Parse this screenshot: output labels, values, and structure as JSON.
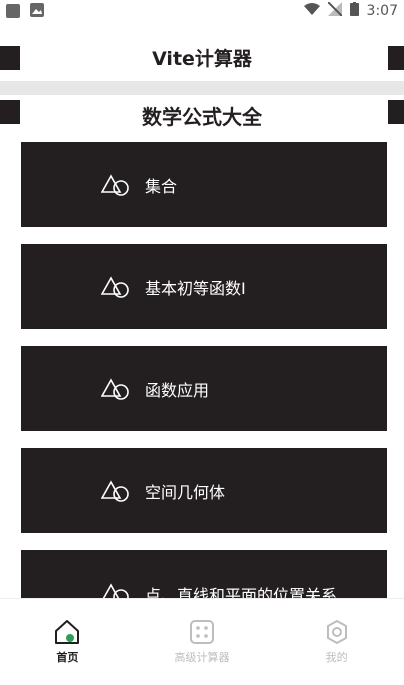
{
  "status_bar": {
    "time": "3:07"
  },
  "header": {
    "title": "Vite计算器"
  },
  "section": {
    "title": "数学公式大全"
  },
  "cards": [
    {
      "label": "集合"
    },
    {
      "label": "基本初等函数I"
    },
    {
      "label": "函数应用"
    },
    {
      "label": "空间几何体"
    },
    {
      "label": "点、直线和平面的位置关系"
    }
  ],
  "bottom_nav": {
    "items": [
      {
        "label": "首页",
        "icon": "home-icon",
        "active": true
      },
      {
        "label": "高级计算器",
        "icon": "calculator-icon",
        "active": false
      },
      {
        "label": "我的",
        "icon": "gear-icon",
        "active": false
      }
    ]
  },
  "colors": {
    "dark": "#231f20",
    "divider": "#e7e7e7",
    "inactive": "#bdbdbd"
  }
}
